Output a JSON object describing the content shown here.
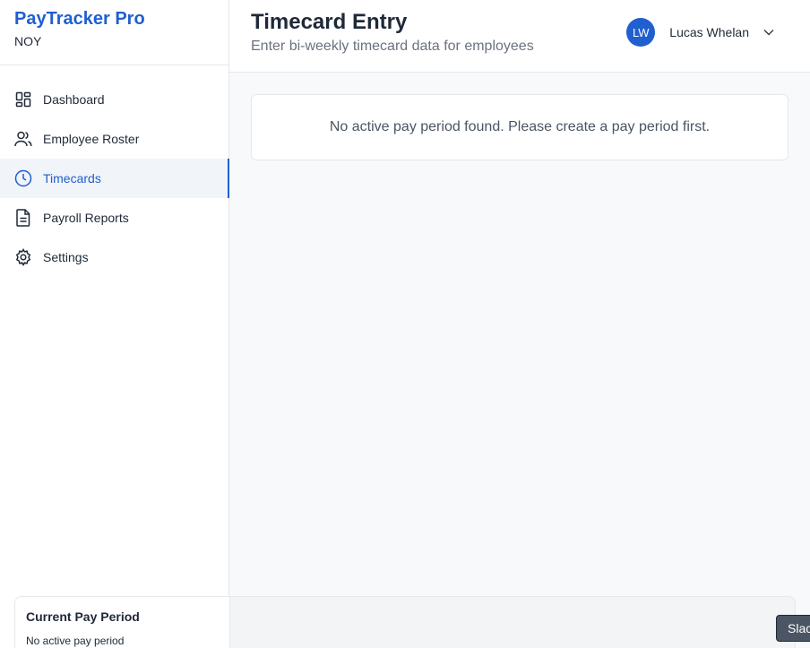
{
  "brand": {
    "title": "PayTracker Pro",
    "subtitle": "NOY"
  },
  "sidebar": {
    "items": [
      {
        "label": "Dashboard",
        "icon": "dashboard-icon"
      },
      {
        "label": "Employee Roster",
        "icon": "users-icon"
      },
      {
        "label": "Timecards",
        "icon": "clock-icon",
        "active": true
      },
      {
        "label": "Payroll Reports",
        "icon": "document-icon"
      },
      {
        "label": "Settings",
        "icon": "gear-icon"
      }
    ],
    "period_card": {
      "title": "Current Pay Period",
      "text": "No active pay period"
    }
  },
  "header": {
    "title": "Timecard Entry",
    "subtitle": "Enter bi-weekly timecard data for employees",
    "user": {
      "initials": "LW",
      "name": "Lucas Whelan"
    }
  },
  "main": {
    "notice": "No active pay period found. Please create a pay period first."
  },
  "tooltip": {
    "text": "Slack"
  },
  "colors": {
    "accent": "#1f5fd0",
    "sidebar_active_bg": "#f1f4f8",
    "muted_text": "#6b7280"
  }
}
